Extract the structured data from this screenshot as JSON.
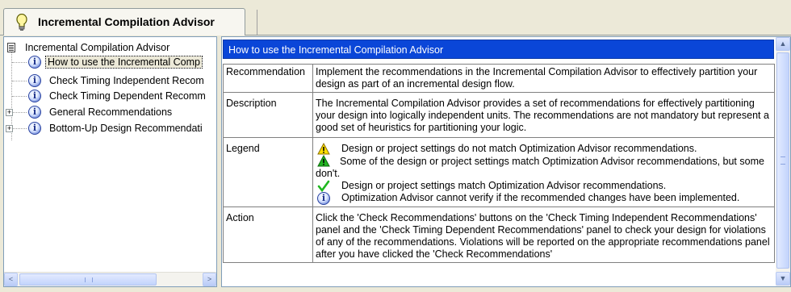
{
  "tab": {
    "title": "Incremental Compilation Advisor"
  },
  "tree": {
    "root": "Incremental Compilation Advisor",
    "items": [
      {
        "label": "How to use the Incremental Comp",
        "expandable": false,
        "selected": true
      },
      {
        "label": "Check Timing Independent Recom",
        "expandable": false,
        "selected": false
      },
      {
        "label": "Check Timing Dependent Recomm",
        "expandable": false,
        "selected": false
      },
      {
        "label": "General Recommendations",
        "expandable": true,
        "selected": false
      },
      {
        "label": "Bottom-Up Design Recommendati",
        "expandable": true,
        "selected": false
      }
    ],
    "scroll_left": "<",
    "scroll_right": ">"
  },
  "content": {
    "heading": "How to use the Incremental Compilation Advisor",
    "rows": {
      "recommendation": {
        "key": "Recommendation",
        "value": "Implement the recommendations in the Incremental Compilation Advisor to effectively partition your design as part of an incremental design flow."
      },
      "description": {
        "key": "Description",
        "value": "The Incremental Compilation Advisor provides a set of recommendations for effectively partitioning your design into logically independent units.  The recommendations are not mandatory but represent a good set of heuristics for partitioning your logic."
      },
      "legend": {
        "key": "Legend",
        "items": [
          {
            "icon": "warning-yellow-icon",
            "text": "Design or project settings do not match Optimization Advisor recommendations."
          },
          {
            "icon": "warning-green-icon",
            "text": "Some of the design or project settings match Optimization Advisor recommendations, but some don't."
          },
          {
            "icon": "check-icon",
            "text": "Design or project settings match Optimization Advisor recommendations."
          },
          {
            "icon": "info-icon",
            "text": "Optimization Advisor cannot verify if the recommended changes have been implemented."
          }
        ]
      },
      "action": {
        "key": "Action",
        "value": "Click the 'Check Recommendations' buttons on the 'Check Timing Independent Recommendations' panel and the 'Check Timing Dependent Recommendations' panel to check your design for violations of any of the recommendations.  Violations will be reported on the appropriate recommendations panel after you have clicked the 'Check Recommendations'"
      }
    }
  },
  "colors": {
    "heading_bg": "#0a46d8",
    "window_bg": "#ece9d8"
  }
}
